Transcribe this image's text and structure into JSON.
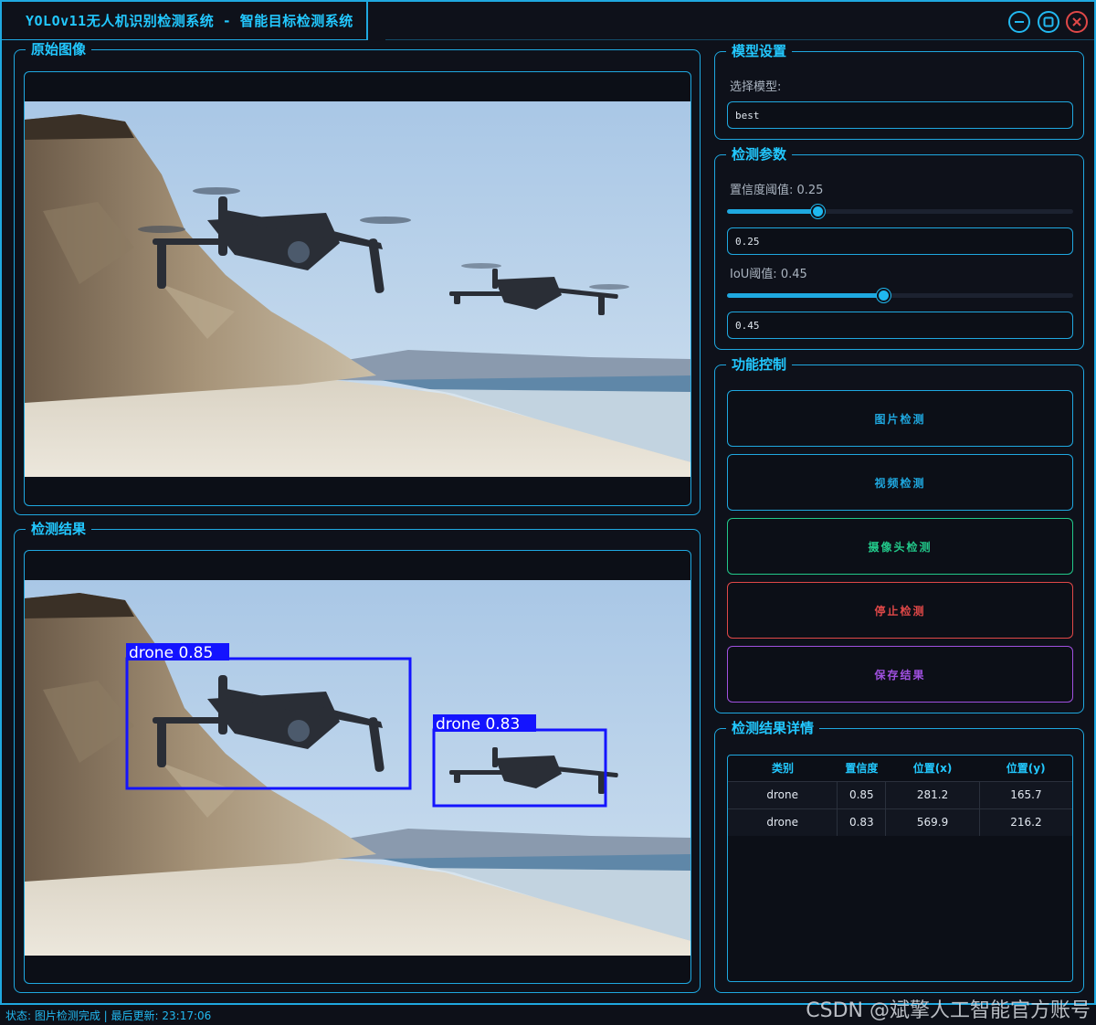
{
  "window": {
    "title": "YOLOv11无人机识别检测系统 - 智能目标检测系统",
    "controls": [
      "minimize",
      "maximize",
      "close"
    ]
  },
  "original_panel": {
    "title": "原始图像"
  },
  "result_panel": {
    "title": "检测结果",
    "detections": [
      {
        "label": "drone 0.85",
        "box_color": "#1414ff"
      },
      {
        "label": "drone 0.83",
        "box_color": "#1414ff"
      }
    ]
  },
  "model_settings": {
    "title": "模型设置",
    "select_label": "选择模型:",
    "selected_model": "best"
  },
  "params": {
    "title": "检测参数",
    "confidence_label": "置信度阈值: 0.25",
    "confidence_value": "0.25",
    "confidence_fraction": 0.26,
    "iou_label": "IoU阈值: 0.45",
    "iou_value": "0.45",
    "iou_fraction": 0.45
  },
  "controls": {
    "title": "功能控制",
    "buttons": [
      {
        "label": "图片检测",
        "color": "#1fa8e0"
      },
      {
        "label": "视频检测",
        "color": "#1fa8e0"
      },
      {
        "label": "摄像头检测",
        "color": "#22c88a"
      },
      {
        "label": "停止检测",
        "color": "#e04848"
      },
      {
        "label": "保存结果",
        "color": "#a050e0"
      }
    ]
  },
  "details": {
    "title": "检测结果详情",
    "columns": [
      "类别",
      "置信度",
      "位置(x)",
      "位置(y)"
    ],
    "rows": [
      [
        "drone",
        "0.85",
        "281.2",
        "165.7"
      ],
      [
        "drone",
        "0.83",
        "569.9",
        "216.2"
      ]
    ]
  },
  "status": {
    "text": "状态: 图片检测完成 | 最后更新: 23:17:06"
  },
  "watermark": "CSDN @斌擎人工智能官方账号",
  "colors": {
    "accent": "#1fa8e0",
    "title": "#22c8ff",
    "background": "#0e111a"
  }
}
